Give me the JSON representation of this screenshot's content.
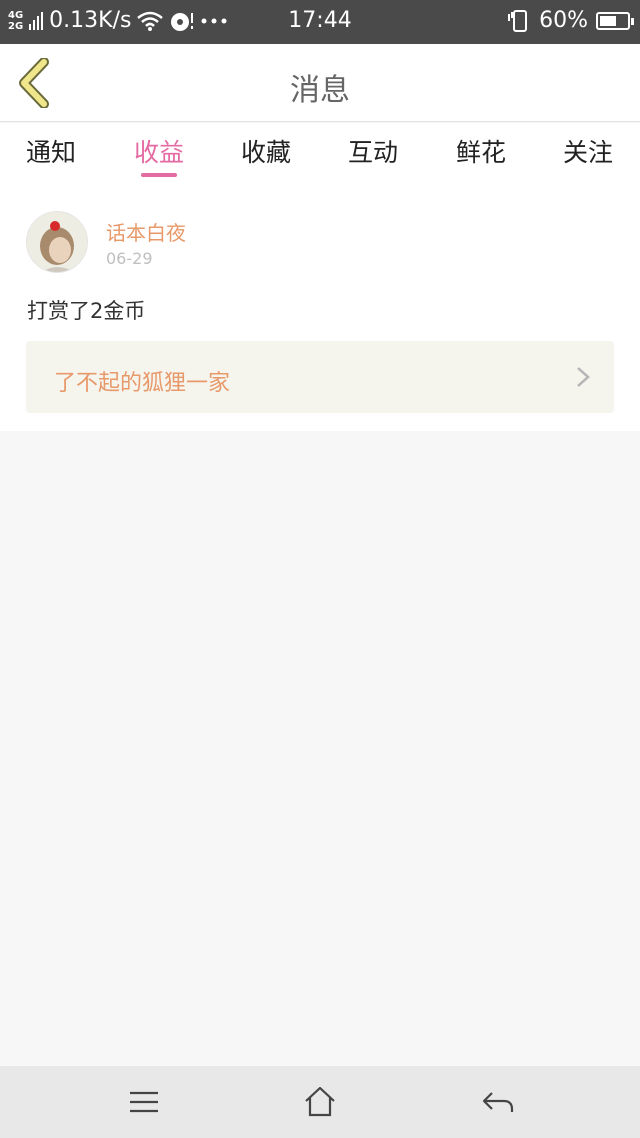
{
  "status_bar": {
    "network_top": "4G",
    "network_bottom": "2G",
    "speed": "0.13K/s",
    "time": "17:44",
    "battery": "60%",
    "battery_level": 0.6
  },
  "header": {
    "title": "消息"
  },
  "tabs": [
    {
      "label": "通知",
      "active": false
    },
    {
      "label": "收益",
      "active": true
    },
    {
      "label": "收藏",
      "active": false
    },
    {
      "label": "互动",
      "active": false
    },
    {
      "label": "鲜花",
      "active": false
    },
    {
      "label": "关注",
      "active": false
    }
  ],
  "message": {
    "username": "话本白夜",
    "date": "06-29",
    "text": "打赏了2金币",
    "book_title": "了不起的狐狸一家"
  },
  "colors": {
    "accent_pink": "#e46aa3",
    "accent_orange": "#e8996a",
    "back_arrow": "#f0e68c"
  }
}
